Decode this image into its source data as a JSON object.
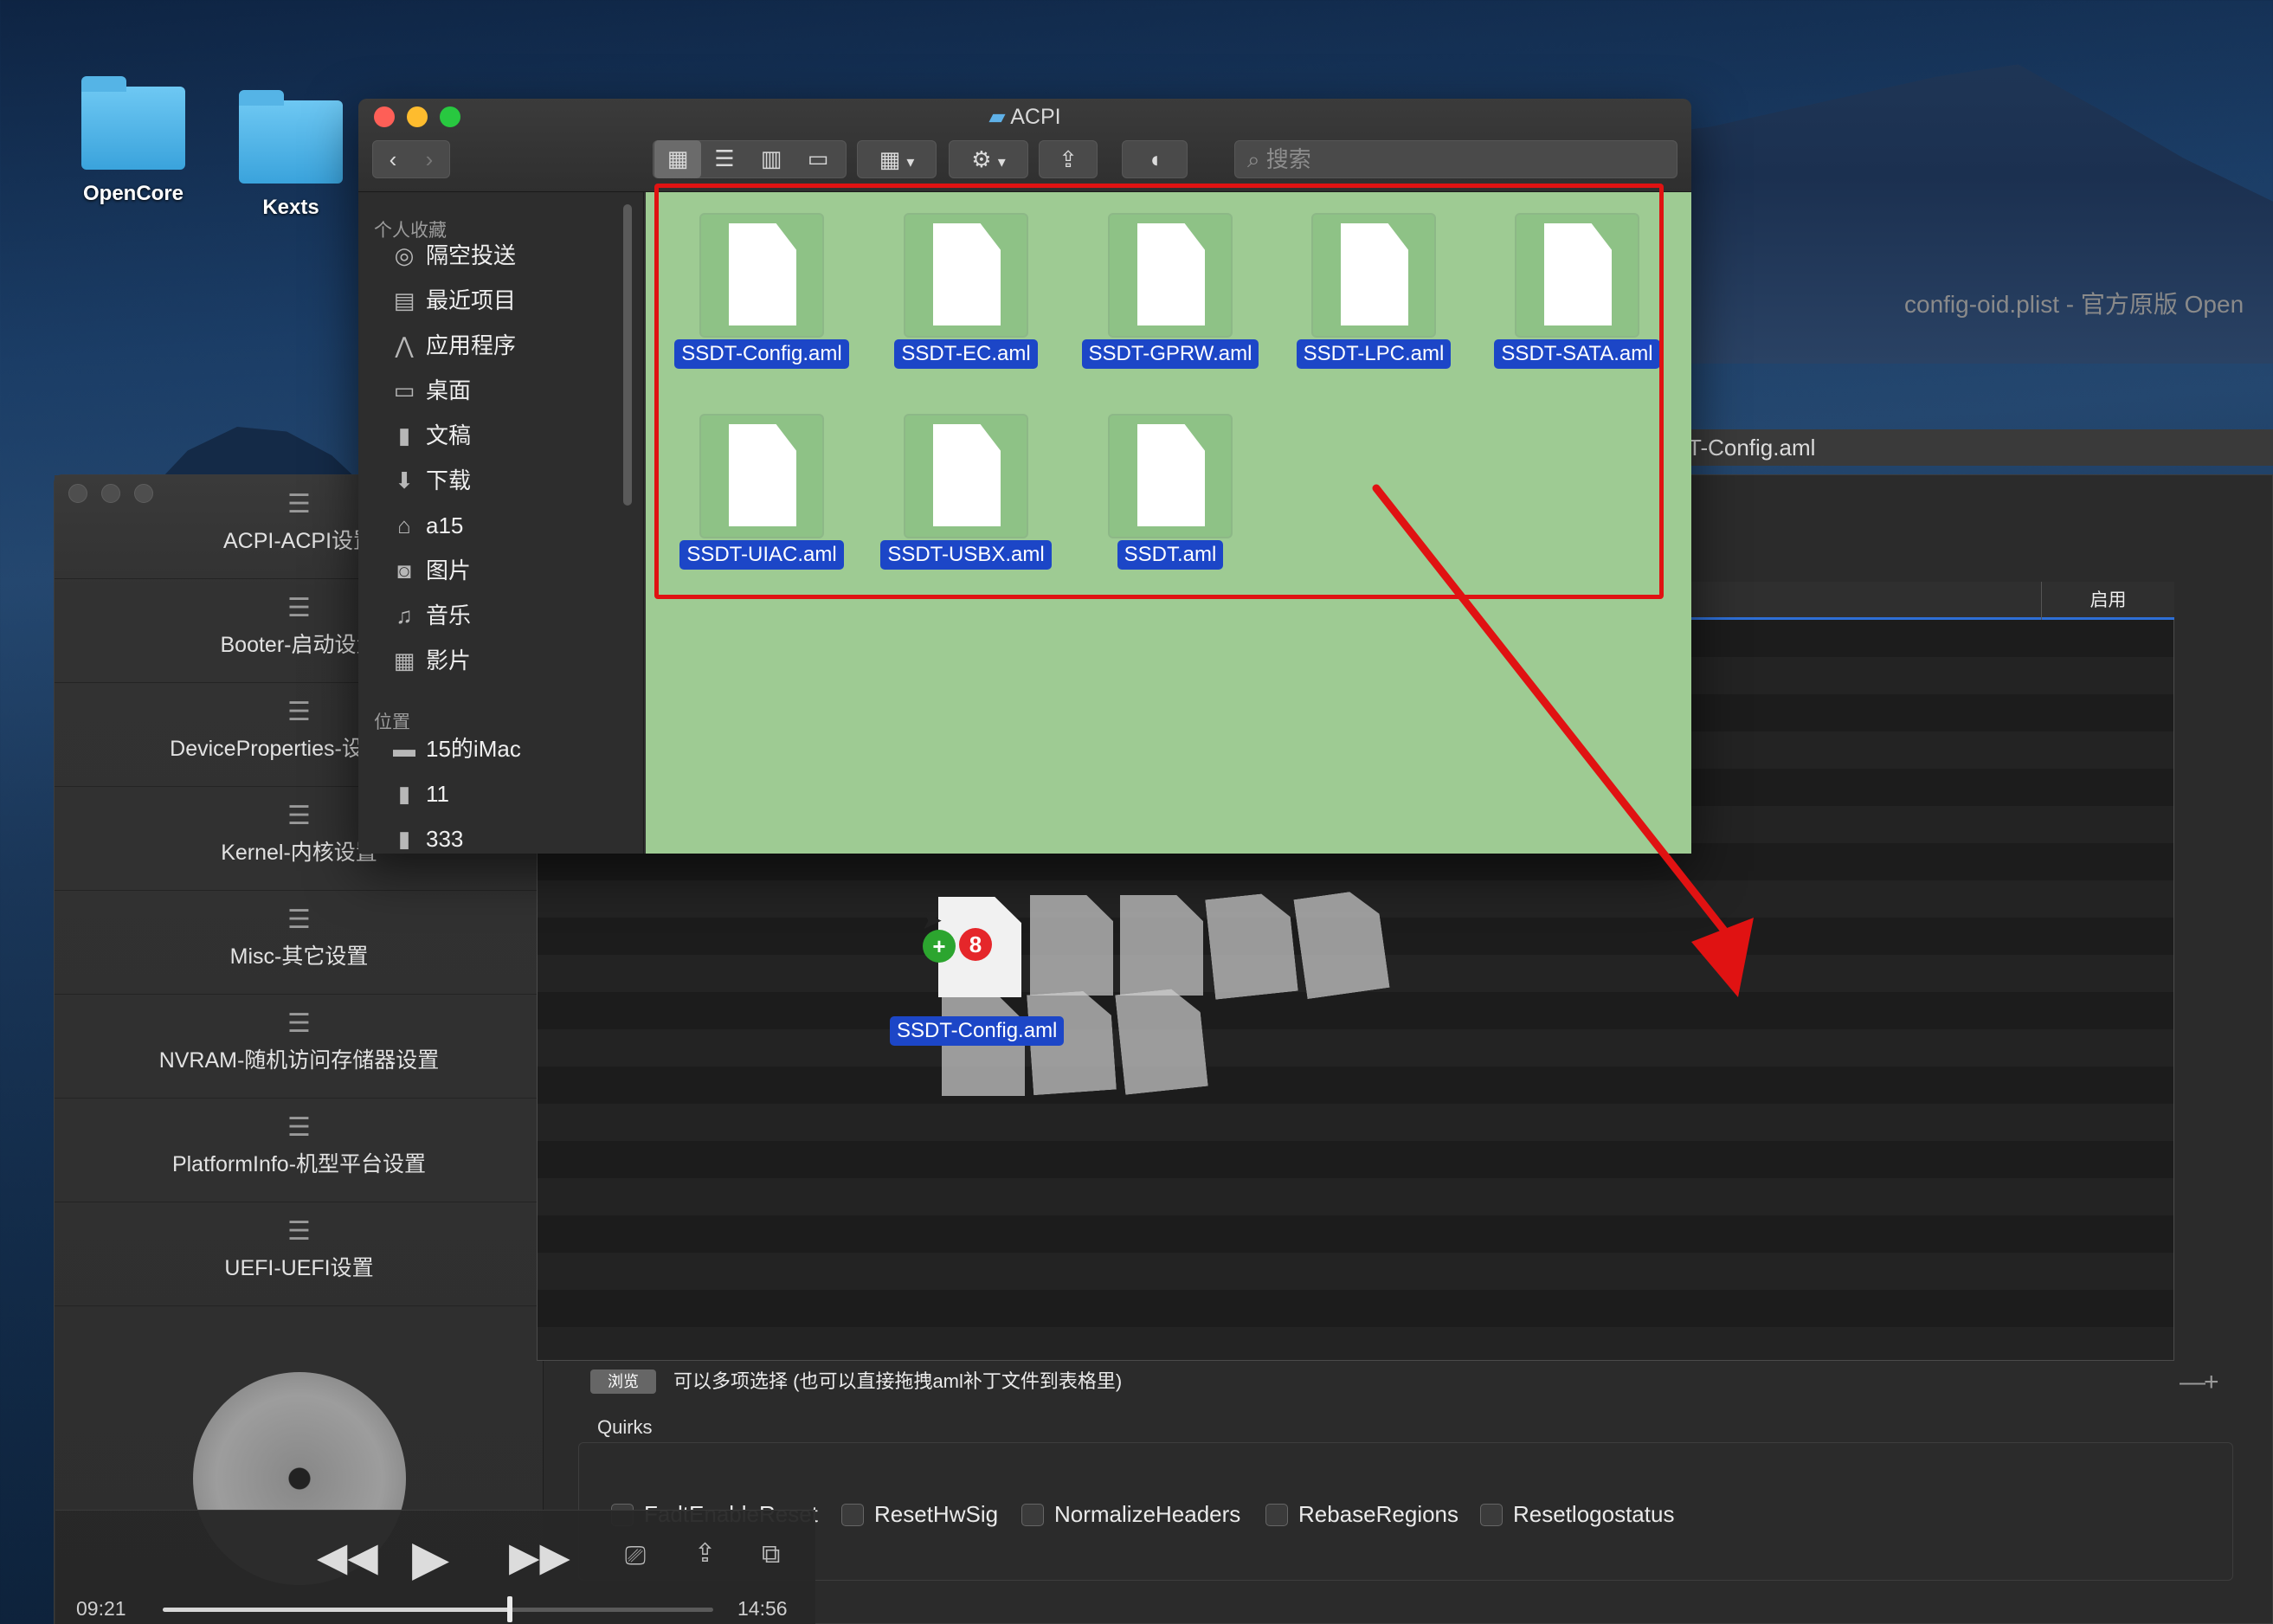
{
  "desktop": {
    "icons": [
      {
        "label": "OpenCore",
        "icon": "folder-icon"
      },
      {
        "label": "Kexts",
        "icon": "folder-icon"
      }
    ]
  },
  "config_app": {
    "title": "config-oid.plist - 官方原版 Open",
    "path_field": "T-Config.aml",
    "sidebar": [
      {
        "label": "ACPI-ACPI设置",
        "icon": "list-icon"
      },
      {
        "label": "Booter-启动设置",
        "icon": "list-icon"
      },
      {
        "label": "DeviceProperties-设备属性",
        "icon": "list-icon"
      },
      {
        "label": "Kernel-内核设置",
        "icon": "list-icon"
      },
      {
        "label": "Misc-其它设置",
        "icon": "list-icon"
      },
      {
        "label": "NVRAM-随机访问存储器设置",
        "icon": "list-icon"
      },
      {
        "label": "PlatformInfo-机型平台设置",
        "icon": "list-icon"
      },
      {
        "label": "UEFI-UEFI设置",
        "icon": "list-icon"
      }
    ],
    "table": {
      "col_enabled": "启用"
    },
    "browse_button": "浏览",
    "hint": "可以多项选择 (也可以直接拖拽aml补丁文件到表格里)",
    "minus": "—",
    "plus": "+",
    "quirks": {
      "title": "Quirks",
      "items": [
        "FadtEnableReset",
        "ResetHwSig",
        "NormalizeHeaders",
        "RebaseRegions",
        "Resetlogostatus"
      ]
    }
  },
  "media_bar": {
    "elapsed": "09:21",
    "total": "14:56",
    "progress": 0.63
  },
  "finder": {
    "title": "ACPI",
    "search_placeholder": "搜索",
    "favorites_header": "个人收藏",
    "favorites": [
      {
        "label": "隔空投送",
        "icon": "airdrop-icon"
      },
      {
        "label": "最近项目",
        "icon": "recents-icon"
      },
      {
        "label": "应用程序",
        "icon": "applications-icon"
      },
      {
        "label": "桌面",
        "icon": "desktop-icon"
      },
      {
        "label": "文稿",
        "icon": "documents-icon"
      },
      {
        "label": "下载",
        "icon": "downloads-icon"
      },
      {
        "label": "a15",
        "icon": "home-icon"
      },
      {
        "label": "图片",
        "icon": "camera-icon"
      },
      {
        "label": "音乐",
        "icon": "music-icon"
      },
      {
        "label": "影片",
        "icon": "film-icon"
      }
    ],
    "locations_header": "位置",
    "locations": [
      {
        "label": "15的iMac",
        "icon": "computer-icon"
      },
      {
        "label": "11",
        "icon": "disk-icon"
      },
      {
        "label": "333",
        "icon": "disk-icon"
      }
    ],
    "files": [
      "SSDT-Config.aml",
      "SSDT-EC.aml",
      "SSDT-GPRW.aml",
      "SSDT-LPC.aml",
      "SSDT-SATA.aml",
      "SSDT-UIAC.aml",
      "SSDT-USBX.aml",
      "SSDT.aml"
    ]
  },
  "drag": {
    "label": "SSDT-Config.aml",
    "count": "8",
    "add_symbol": "+"
  },
  "colors": {
    "finder_content_bg": "#9ecb93",
    "selection_blue": "#1c46c7",
    "annotation_red": "#e01212",
    "traffic_red": "#fe5f57",
    "traffic_yellow": "#febc2e",
    "traffic_green": "#28c840"
  }
}
